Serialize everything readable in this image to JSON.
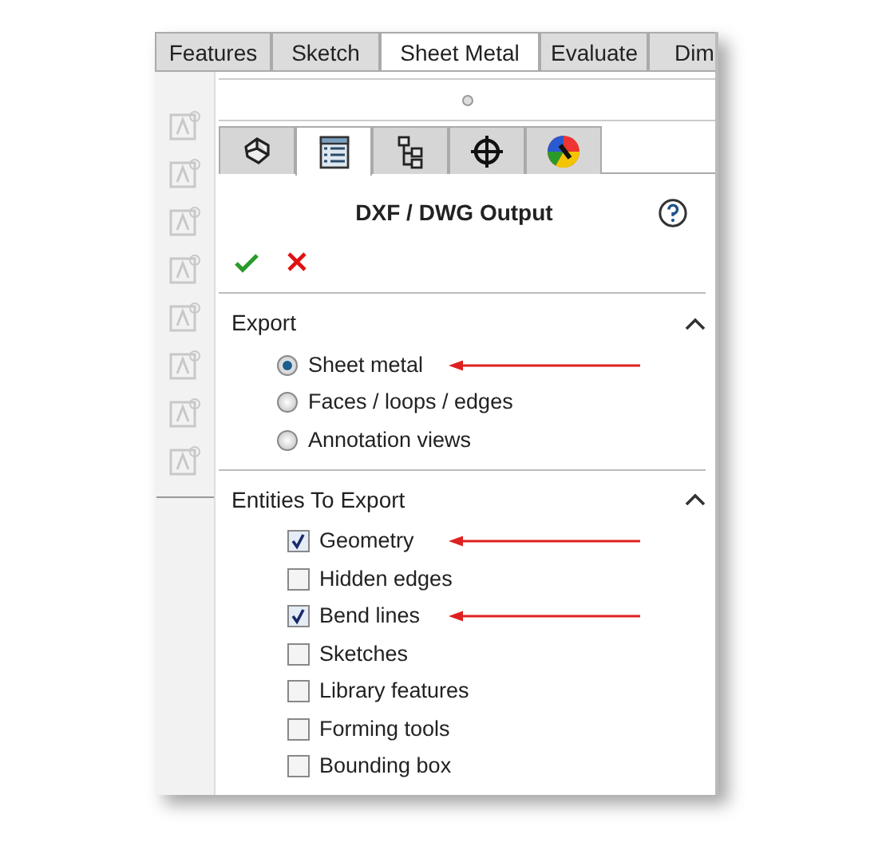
{
  "command_tabs": [
    {
      "label": "Features",
      "selected": false
    },
    {
      "label": "Sketch",
      "selected": false
    },
    {
      "label": "Sheet Metal",
      "selected": true
    },
    {
      "label": "Evaluate",
      "selected": false
    },
    {
      "label": "Dim",
      "selected": false
    }
  ],
  "panel_tabs": [
    {
      "kind": "part",
      "selected": false
    },
    {
      "kind": "properties",
      "selected": true
    },
    {
      "kind": "tree",
      "selected": false
    },
    {
      "kind": "target",
      "selected": false
    },
    {
      "kind": "appearance",
      "selected": false
    }
  ],
  "title": "DXF / DWG Output",
  "sections": [
    {
      "title": "Export",
      "expanded": true,
      "kind": "radio",
      "options": [
        {
          "label": "Sheet metal",
          "selected": true,
          "arrow": true
        },
        {
          "label": "Faces / loops / edges",
          "selected": false,
          "arrow": false
        },
        {
          "label": "Annotation views",
          "selected": false,
          "arrow": false
        }
      ]
    },
    {
      "title": "Entities To Export",
      "expanded": true,
      "kind": "checkbox",
      "options": [
        {
          "label": "Geometry",
          "checked": true,
          "arrow": true
        },
        {
          "label": "Hidden edges",
          "checked": false,
          "arrow": false
        },
        {
          "label": "Bend lines",
          "checked": true,
          "arrow": true
        },
        {
          "label": "Sketches",
          "checked": false,
          "arrow": false
        },
        {
          "label": "Library features",
          "checked": false,
          "arrow": false
        },
        {
          "label": "Forming tools",
          "checked": false,
          "arrow": false
        },
        {
          "label": "Bounding box",
          "checked": false,
          "arrow": false
        }
      ]
    }
  ]
}
